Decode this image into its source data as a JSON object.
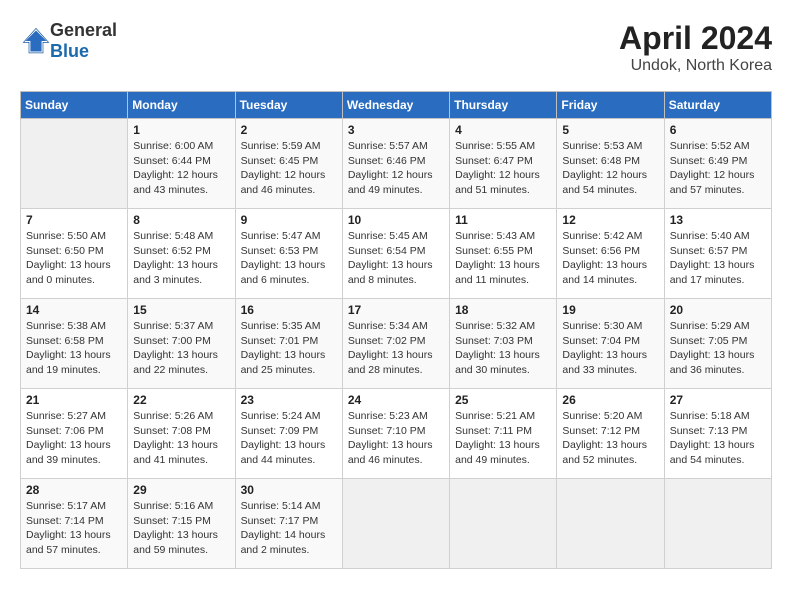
{
  "header": {
    "logo_general": "General",
    "logo_blue": "Blue",
    "title": "April 2024",
    "subtitle": "Undok, North Korea"
  },
  "calendar": {
    "columns": [
      "Sunday",
      "Monday",
      "Tuesday",
      "Wednesday",
      "Thursday",
      "Friday",
      "Saturday"
    ],
    "weeks": [
      [
        {
          "day": "",
          "sunrise": "",
          "sunset": "",
          "daylight": ""
        },
        {
          "day": "1",
          "sunrise": "Sunrise: 6:00 AM",
          "sunset": "Sunset: 6:44 PM",
          "daylight": "Daylight: 12 hours and 43 minutes."
        },
        {
          "day": "2",
          "sunrise": "Sunrise: 5:59 AM",
          "sunset": "Sunset: 6:45 PM",
          "daylight": "Daylight: 12 hours and 46 minutes."
        },
        {
          "day": "3",
          "sunrise": "Sunrise: 5:57 AM",
          "sunset": "Sunset: 6:46 PM",
          "daylight": "Daylight: 12 hours and 49 minutes."
        },
        {
          "day": "4",
          "sunrise": "Sunrise: 5:55 AM",
          "sunset": "Sunset: 6:47 PM",
          "daylight": "Daylight: 12 hours and 51 minutes."
        },
        {
          "day": "5",
          "sunrise": "Sunrise: 5:53 AM",
          "sunset": "Sunset: 6:48 PM",
          "daylight": "Daylight: 12 hours and 54 minutes."
        },
        {
          "day": "6",
          "sunrise": "Sunrise: 5:52 AM",
          "sunset": "Sunset: 6:49 PM",
          "daylight": "Daylight: 12 hours and 57 minutes."
        }
      ],
      [
        {
          "day": "7",
          "sunrise": "Sunrise: 5:50 AM",
          "sunset": "Sunset: 6:50 PM",
          "daylight": "Daylight: 13 hours and 0 minutes."
        },
        {
          "day": "8",
          "sunrise": "Sunrise: 5:48 AM",
          "sunset": "Sunset: 6:52 PM",
          "daylight": "Daylight: 13 hours and 3 minutes."
        },
        {
          "day": "9",
          "sunrise": "Sunrise: 5:47 AM",
          "sunset": "Sunset: 6:53 PM",
          "daylight": "Daylight: 13 hours and 6 minutes."
        },
        {
          "day": "10",
          "sunrise": "Sunrise: 5:45 AM",
          "sunset": "Sunset: 6:54 PM",
          "daylight": "Daylight: 13 hours and 8 minutes."
        },
        {
          "day": "11",
          "sunrise": "Sunrise: 5:43 AM",
          "sunset": "Sunset: 6:55 PM",
          "daylight": "Daylight: 13 hours and 11 minutes."
        },
        {
          "day": "12",
          "sunrise": "Sunrise: 5:42 AM",
          "sunset": "Sunset: 6:56 PM",
          "daylight": "Daylight: 13 hours and 14 minutes."
        },
        {
          "day": "13",
          "sunrise": "Sunrise: 5:40 AM",
          "sunset": "Sunset: 6:57 PM",
          "daylight": "Daylight: 13 hours and 17 minutes."
        }
      ],
      [
        {
          "day": "14",
          "sunrise": "Sunrise: 5:38 AM",
          "sunset": "Sunset: 6:58 PM",
          "daylight": "Daylight: 13 hours and 19 minutes."
        },
        {
          "day": "15",
          "sunrise": "Sunrise: 5:37 AM",
          "sunset": "Sunset: 7:00 PM",
          "daylight": "Daylight: 13 hours and 22 minutes."
        },
        {
          "day": "16",
          "sunrise": "Sunrise: 5:35 AM",
          "sunset": "Sunset: 7:01 PM",
          "daylight": "Daylight: 13 hours and 25 minutes."
        },
        {
          "day": "17",
          "sunrise": "Sunrise: 5:34 AM",
          "sunset": "Sunset: 7:02 PM",
          "daylight": "Daylight: 13 hours and 28 minutes."
        },
        {
          "day": "18",
          "sunrise": "Sunrise: 5:32 AM",
          "sunset": "Sunset: 7:03 PM",
          "daylight": "Daylight: 13 hours and 30 minutes."
        },
        {
          "day": "19",
          "sunrise": "Sunrise: 5:30 AM",
          "sunset": "Sunset: 7:04 PM",
          "daylight": "Daylight: 13 hours and 33 minutes."
        },
        {
          "day": "20",
          "sunrise": "Sunrise: 5:29 AM",
          "sunset": "Sunset: 7:05 PM",
          "daylight": "Daylight: 13 hours and 36 minutes."
        }
      ],
      [
        {
          "day": "21",
          "sunrise": "Sunrise: 5:27 AM",
          "sunset": "Sunset: 7:06 PM",
          "daylight": "Daylight: 13 hours and 39 minutes."
        },
        {
          "day": "22",
          "sunrise": "Sunrise: 5:26 AM",
          "sunset": "Sunset: 7:08 PM",
          "daylight": "Daylight: 13 hours and 41 minutes."
        },
        {
          "day": "23",
          "sunrise": "Sunrise: 5:24 AM",
          "sunset": "Sunset: 7:09 PM",
          "daylight": "Daylight: 13 hours and 44 minutes."
        },
        {
          "day": "24",
          "sunrise": "Sunrise: 5:23 AM",
          "sunset": "Sunset: 7:10 PM",
          "daylight": "Daylight: 13 hours and 46 minutes."
        },
        {
          "day": "25",
          "sunrise": "Sunrise: 5:21 AM",
          "sunset": "Sunset: 7:11 PM",
          "daylight": "Daylight: 13 hours and 49 minutes."
        },
        {
          "day": "26",
          "sunrise": "Sunrise: 5:20 AM",
          "sunset": "Sunset: 7:12 PM",
          "daylight": "Daylight: 13 hours and 52 minutes."
        },
        {
          "day": "27",
          "sunrise": "Sunrise: 5:18 AM",
          "sunset": "Sunset: 7:13 PM",
          "daylight": "Daylight: 13 hours and 54 minutes."
        }
      ],
      [
        {
          "day": "28",
          "sunrise": "Sunrise: 5:17 AM",
          "sunset": "Sunset: 7:14 PM",
          "daylight": "Daylight: 13 hours and 57 minutes."
        },
        {
          "day": "29",
          "sunrise": "Sunrise: 5:16 AM",
          "sunset": "Sunset: 7:15 PM",
          "daylight": "Daylight: 13 hours and 59 minutes."
        },
        {
          "day": "30",
          "sunrise": "Sunrise: 5:14 AM",
          "sunset": "Sunset: 7:17 PM",
          "daylight": "Daylight: 14 hours and 2 minutes."
        },
        {
          "day": "",
          "sunrise": "",
          "sunset": "",
          "daylight": ""
        },
        {
          "day": "",
          "sunrise": "",
          "sunset": "",
          "daylight": ""
        },
        {
          "day": "",
          "sunrise": "",
          "sunset": "",
          "daylight": ""
        },
        {
          "day": "",
          "sunrise": "",
          "sunset": "",
          "daylight": ""
        }
      ]
    ]
  }
}
